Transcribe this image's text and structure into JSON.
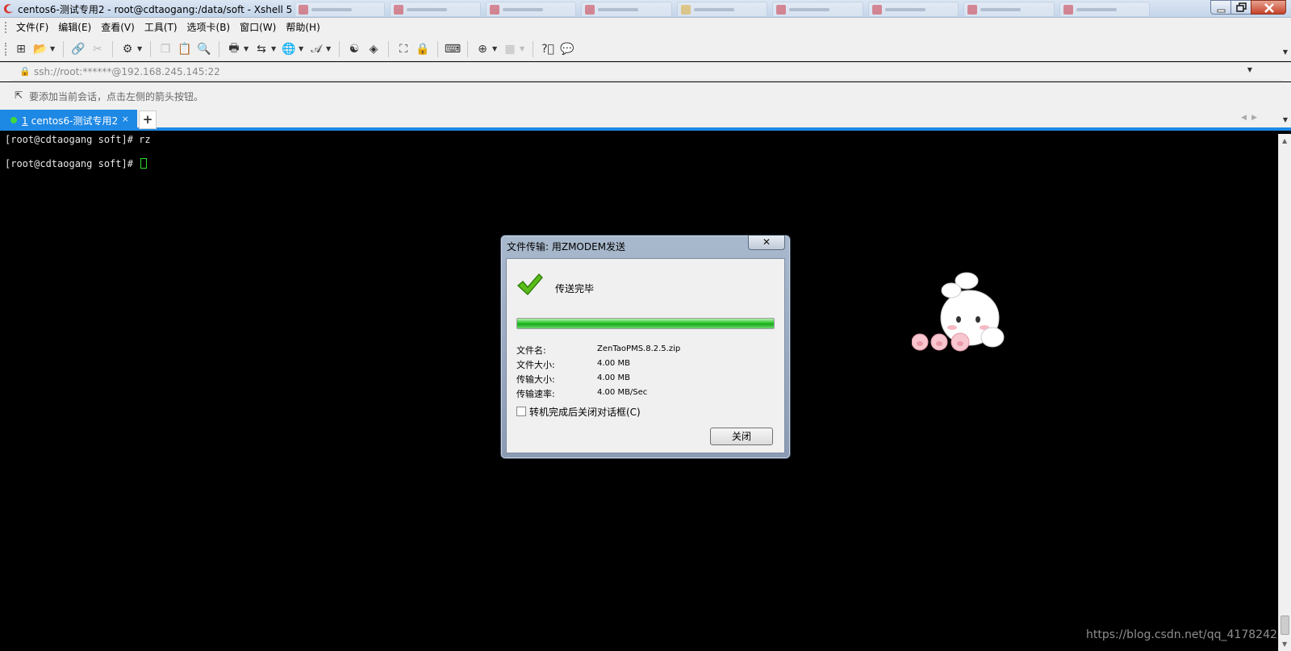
{
  "window": {
    "title": "centos6-测试专用2 - root@cdtaogang:/data/soft - Xshell 5"
  },
  "menu": [
    "文件(F)",
    "编辑(E)",
    "查看(V)",
    "工具(T)",
    "选项卡(B)",
    "窗口(W)",
    "帮助(H)"
  ],
  "address": {
    "url": "ssh://root:******@192.168.245.145:22"
  },
  "hint": {
    "text": "要添加当前会话，点击左侧的箭头按钮。"
  },
  "tabs": [
    {
      "number": "1",
      "label": "centos6-测试专用2",
      "close": "×",
      "active": true
    }
  ],
  "tab_add": "+",
  "terminal": {
    "lines": [
      "[root@cdtaogang soft]# rz",
      "[root@cdtaogang soft]# "
    ]
  },
  "dialog": {
    "title": "文件传输: 用ZMODEM发送",
    "close_glyph": "✕",
    "status": "传送完毕",
    "progress": 1.0,
    "fields": [
      {
        "label": "文件名:",
        "value": "ZenTaoPMS.8.2.5.zip"
      },
      {
        "label": "文件大小:",
        "value": "4.00 MB"
      },
      {
        "label": "传输大小:",
        "value": "4.00 MB"
      },
      {
        "label": "传输速率:",
        "value": "4.00 MB/Sec"
      }
    ],
    "checkbox_label": "转机完成后关闭对话框(C)",
    "checkbox_checked": false,
    "close_button": "关闭"
  },
  "watermark": "https://blog.csdn.net/qq_4178242",
  "colors": {
    "tab_active": "#1e88e5",
    "cursor": "#2bdc2b",
    "progress": "#29c429"
  }
}
